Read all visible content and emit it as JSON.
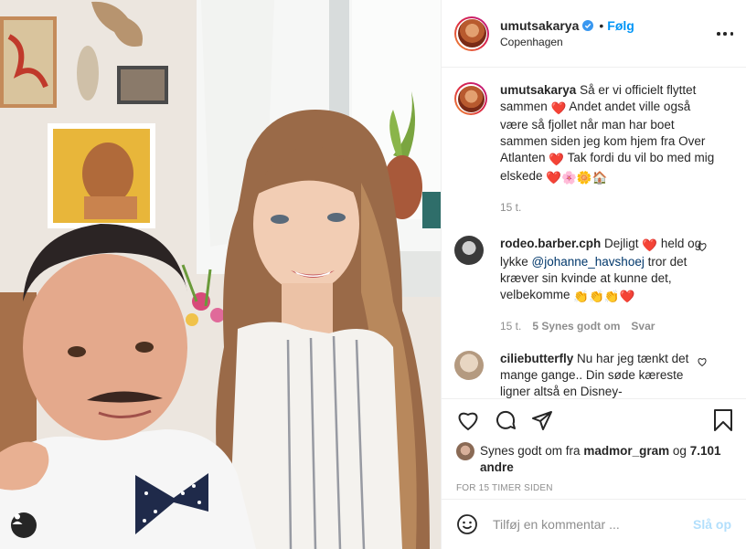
{
  "post": {
    "username": "umutsakarya",
    "follow_label": "Følg",
    "separator": "•",
    "location": "Copenhagen",
    "caption_username": "umutsakarya",
    "caption_part1": "Så er vi officielt flyttet sammen",
    "caption_part2": "Andet andet ville også være så fjollet når man har boet sammen siden jeg kom hjem fra Over Atlanten",
    "caption_part3": "Tak fordi du vil bo med mig elskede",
    "caption_time": "15 t."
  },
  "comments": [
    {
      "username": "rodeo.barber.cph",
      "text1": "Dejligt",
      "text2": "held og lykke",
      "mention": "@johanne_havshoej",
      "text3": "tror det kræver sin kvinde at kunne det, velbekomme",
      "time": "15 t.",
      "likes": "5 Synes godt om",
      "reply": "Svar"
    },
    {
      "username": "ciliebutterfly",
      "text": "Nu har jeg tænkt det mange gange.. Din søde kæreste ligner altså en Disney-"
    }
  ],
  "likes": {
    "prefix": "Synes godt om fra",
    "user": "madmor_gram",
    "conj": "og",
    "others": "7.101 andre"
  },
  "timeago": "FOR 15 TIMER SIDEN",
  "add_comment": {
    "placeholder": "Tilføj en kommentar ...",
    "post_label": "Slå op"
  },
  "colors": {
    "accent": "#0095f6",
    "heart": "#e0245e",
    "secondary_text": "#8e8e8e"
  },
  "icons": [
    "verified-icon",
    "more-options-icon",
    "heart-icon",
    "comment-icon",
    "share-icon",
    "bookmark-icon",
    "emoji-icon",
    "user-tag-icon"
  ]
}
